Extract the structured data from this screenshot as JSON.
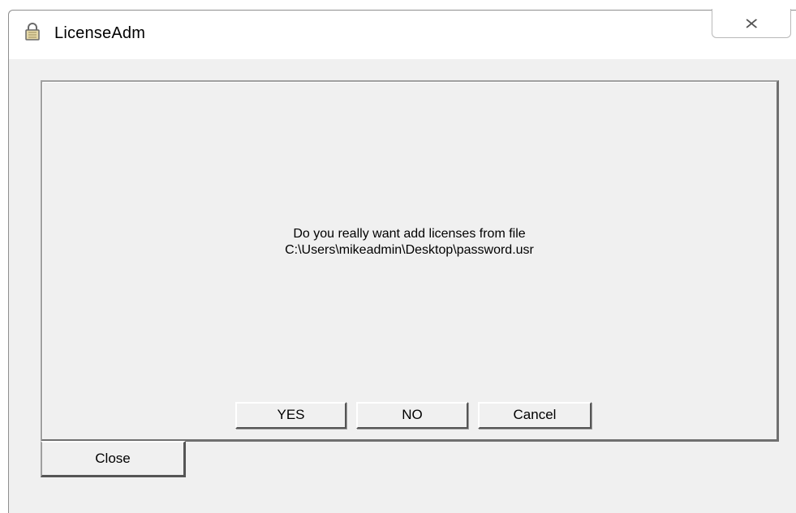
{
  "window": {
    "title": "LicenseAdm",
    "icon": "lock-icon",
    "close_icon": "close-icon"
  },
  "dialog": {
    "message_line1": "Do you really want add licenses from file",
    "message_line2": "C:\\Users\\mikeadmin\\Desktop\\password.usr",
    "yes_label": "YES",
    "no_label": "NO",
    "cancel_label": "Cancel"
  },
  "footer": {
    "close_label": "Close"
  },
  "colors": {
    "window_bg": "#f0f0f0",
    "titlebar_bg": "#ffffff"
  }
}
